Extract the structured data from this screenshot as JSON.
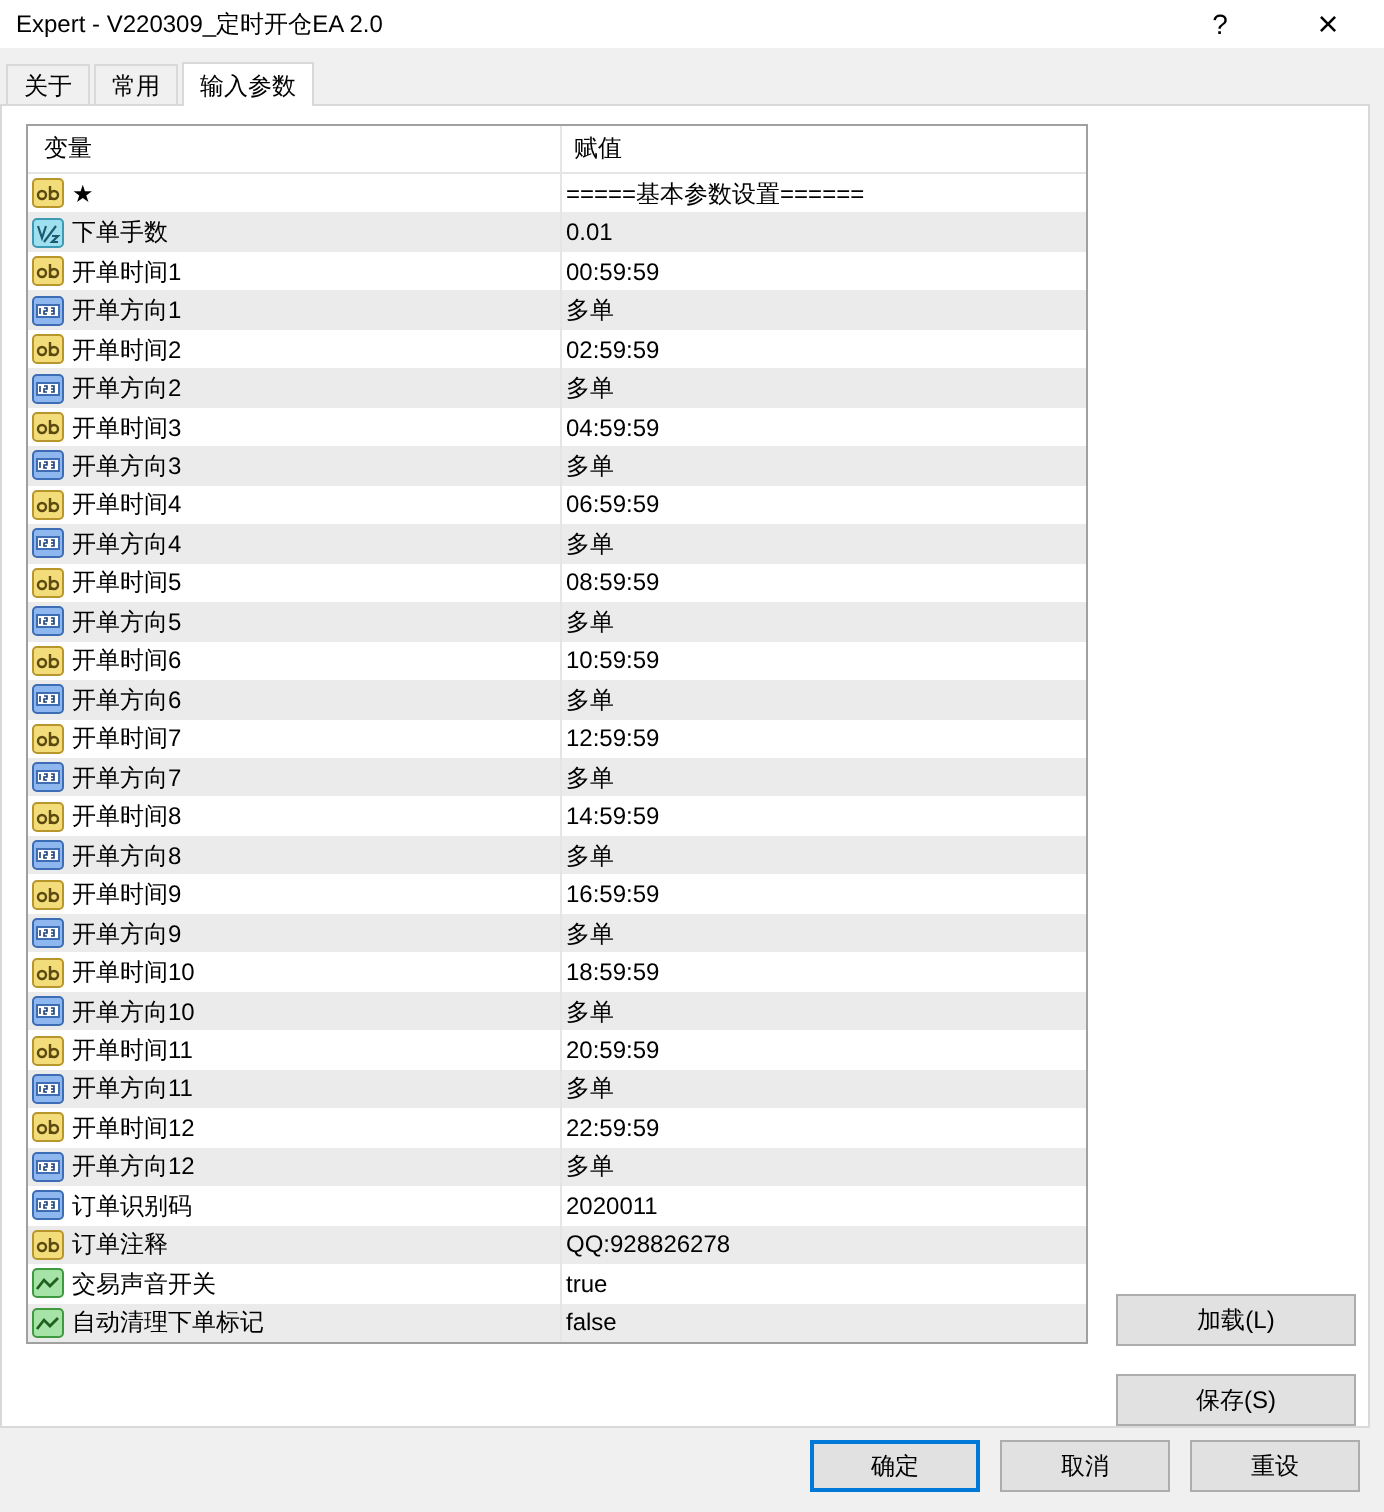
{
  "window": {
    "title": "Expert - V220309_定时开仓EA 2.0",
    "help": "?",
    "close": "×"
  },
  "tabs": [
    {
      "label": "关于",
      "selected": false
    },
    {
      "label": "常用",
      "selected": false
    },
    {
      "label": "输入参数",
      "selected": true
    }
  ],
  "table": {
    "columns": [
      "变量",
      "赋值"
    ],
    "rows": [
      {
        "kind": "string",
        "name": "★",
        "value": "=====基本参数设置======"
      },
      {
        "kind": "double",
        "name": "下单手数",
        "value": "0.01"
      },
      {
        "kind": "string",
        "name": "开单时间1",
        "value": "00:59:59"
      },
      {
        "kind": "int",
        "name": "开单方向1",
        "value": "多单"
      },
      {
        "kind": "string",
        "name": "开单时间2",
        "value": "02:59:59"
      },
      {
        "kind": "int",
        "name": "开单方向2",
        "value": "多单"
      },
      {
        "kind": "string",
        "name": "开单时间3",
        "value": "04:59:59"
      },
      {
        "kind": "int",
        "name": "开单方向3",
        "value": "多单"
      },
      {
        "kind": "string",
        "name": "开单时间4",
        "value": "06:59:59"
      },
      {
        "kind": "int",
        "name": "开单方向4",
        "value": "多单"
      },
      {
        "kind": "string",
        "name": "开单时间5",
        "value": "08:59:59"
      },
      {
        "kind": "int",
        "name": "开单方向5",
        "value": "多单"
      },
      {
        "kind": "string",
        "name": "开单时间6",
        "value": "10:59:59"
      },
      {
        "kind": "int",
        "name": "开单方向6",
        "value": "多单"
      },
      {
        "kind": "string",
        "name": "开单时间7",
        "value": "12:59:59"
      },
      {
        "kind": "int",
        "name": "开单方向7",
        "value": "多单"
      },
      {
        "kind": "string",
        "name": "开单时间8",
        "value": "14:59:59"
      },
      {
        "kind": "int",
        "name": "开单方向8",
        "value": "多单"
      },
      {
        "kind": "string",
        "name": "开单时间9",
        "value": "16:59:59"
      },
      {
        "kind": "int",
        "name": "开单方向9",
        "value": "多单"
      },
      {
        "kind": "string",
        "name": "开单时间10",
        "value": "18:59:59"
      },
      {
        "kind": "int",
        "name": "开单方向10",
        "value": "多单"
      },
      {
        "kind": "string",
        "name": "开单时间11",
        "value": "20:59:59"
      },
      {
        "kind": "int",
        "name": "开单方向11",
        "value": "多单"
      },
      {
        "kind": "string",
        "name": "开单时间12",
        "value": "22:59:59"
      },
      {
        "kind": "int",
        "name": "开单方向12",
        "value": "多单"
      },
      {
        "kind": "int",
        "name": "订单识别码",
        "value": "2020011"
      },
      {
        "kind": "string",
        "name": "订单注释",
        "value": "QQ:928826278"
      },
      {
        "kind": "bool",
        "name": "交易声音开关",
        "value": "true"
      },
      {
        "kind": "bool",
        "name": "自动清理下单标记",
        "value": "false"
      }
    ]
  },
  "side_buttons": [
    "加载(L)",
    "保存(S)"
  ],
  "buttons": [
    {
      "label": "确定",
      "default": true
    },
    {
      "label": "取消",
      "default": false
    },
    {
      "label": "重设",
      "default": false
    }
  ]
}
